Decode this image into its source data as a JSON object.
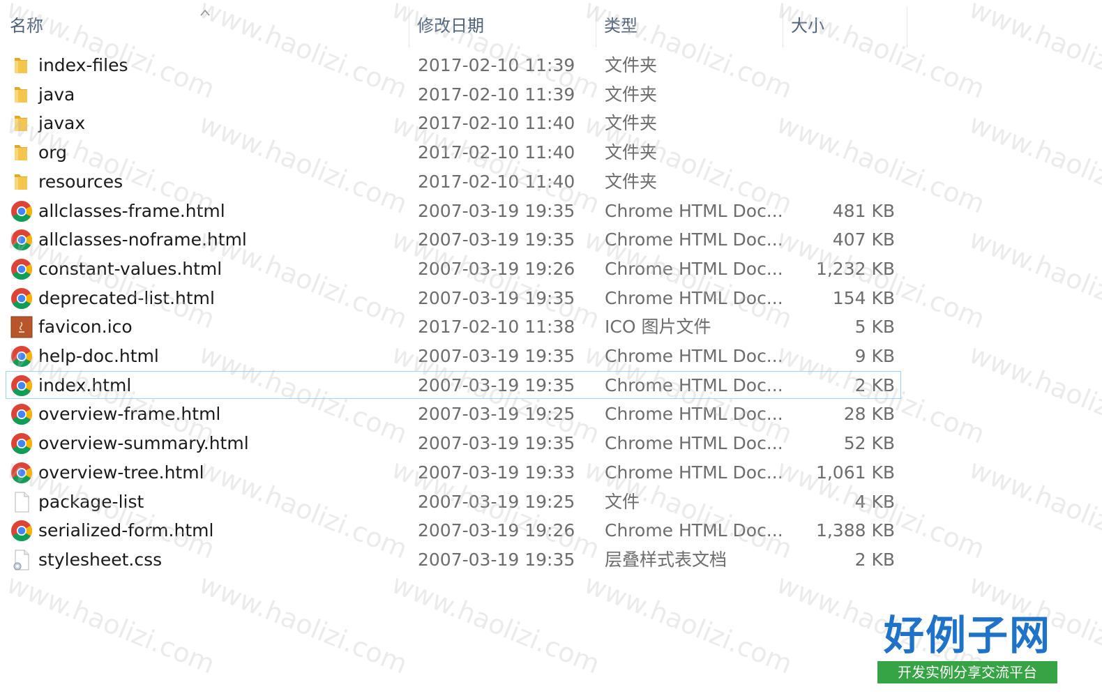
{
  "columns": {
    "name": "名称",
    "date": "修改日期",
    "type": "类型",
    "size": "大小"
  },
  "icons": {
    "folder": "folder-icon",
    "chrome": "chrome-html-icon",
    "java_ico": "java-ico-icon",
    "file": "blank-file-icon",
    "css": "css-file-icon"
  },
  "colors": {
    "folder": "#f4c64e",
    "chrome_red": "#db4437",
    "chrome_yellow": "#f4b400",
    "chrome_green": "#0f9d58",
    "chrome_blue": "#4285f4",
    "selection_border": "#9fd0ef",
    "header_text": "#4c607a",
    "logo_blue": "#1e73c8",
    "logo_green": "#36a444"
  },
  "files": [
    {
      "name": "index-files",
      "date": "2017-02-10 11:39",
      "type": "文件夹",
      "size": "",
      "icon": "folder"
    },
    {
      "name": "java",
      "date": "2017-02-10 11:39",
      "type": "文件夹",
      "size": "",
      "icon": "folder"
    },
    {
      "name": "javax",
      "date": "2017-02-10 11:40",
      "type": "文件夹",
      "size": "",
      "icon": "folder"
    },
    {
      "name": "org",
      "date": "2017-02-10 11:40",
      "type": "文件夹",
      "size": "",
      "icon": "folder"
    },
    {
      "name": "resources",
      "date": "2017-02-10 11:40",
      "type": "文件夹",
      "size": "",
      "icon": "folder"
    },
    {
      "name": "allclasses-frame.html",
      "date": "2007-03-19 19:35",
      "type": "Chrome HTML Doc...",
      "size": "481 KB",
      "icon": "chrome"
    },
    {
      "name": "allclasses-noframe.html",
      "date": "2007-03-19 19:35",
      "type": "Chrome HTML Doc...",
      "size": "407 KB",
      "icon": "chrome"
    },
    {
      "name": "constant-values.html",
      "date": "2007-03-19 19:26",
      "type": "Chrome HTML Doc...",
      "size": "1,232 KB",
      "icon": "chrome"
    },
    {
      "name": "deprecated-list.html",
      "date": "2007-03-19 19:35",
      "type": "Chrome HTML Doc...",
      "size": "154 KB",
      "icon": "chrome"
    },
    {
      "name": "favicon.ico",
      "date": "2017-02-10 11:38",
      "type": "ICO 图片文件",
      "size": "5 KB",
      "icon": "java_ico"
    },
    {
      "name": "help-doc.html",
      "date": "2007-03-19 19:35",
      "type": "Chrome HTML Doc...",
      "size": "9 KB",
      "icon": "chrome"
    },
    {
      "name": "index.html",
      "date": "2007-03-19 19:35",
      "type": "Chrome HTML Doc...",
      "size": "2 KB",
      "icon": "chrome",
      "selected": true
    },
    {
      "name": "overview-frame.html",
      "date": "2007-03-19 19:25",
      "type": "Chrome HTML Doc...",
      "size": "28 KB",
      "icon": "chrome"
    },
    {
      "name": "overview-summary.html",
      "date": "2007-03-19 19:35",
      "type": "Chrome HTML Doc...",
      "size": "52 KB",
      "icon": "chrome"
    },
    {
      "name": "overview-tree.html",
      "date": "2007-03-19 19:33",
      "type": "Chrome HTML Doc...",
      "size": "1,061 KB",
      "icon": "chrome"
    },
    {
      "name": "package-list",
      "date": "2007-03-19 19:25",
      "type": "文件",
      "size": "4 KB",
      "icon": "file"
    },
    {
      "name": "serialized-form.html",
      "date": "2007-03-19 19:26",
      "type": "Chrome HTML Doc...",
      "size": "1,388 KB",
      "icon": "chrome"
    },
    {
      "name": "stylesheet.css",
      "date": "2007-03-19 19:35",
      "type": "层叠样式表文档",
      "size": "2 KB",
      "icon": "css"
    }
  ],
  "watermark": {
    "text": "www.haolizi.com"
  },
  "logo": {
    "main": "好例子网",
    "sub": "开发实例分享交流平台"
  }
}
